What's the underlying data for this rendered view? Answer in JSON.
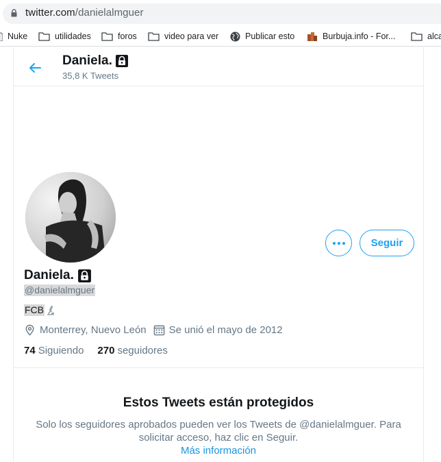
{
  "browser": {
    "url_domain": "twitter.com",
    "url_path": "/danielalmguer",
    "bookmarks": [
      {
        "label": "Nuke",
        "icon": "folder-icon"
      },
      {
        "label": "utilidades",
        "icon": "folder-icon"
      },
      {
        "label": "foros",
        "icon": "folder-icon"
      },
      {
        "label": "video para ver",
        "icon": "folder-icon"
      },
      {
        "label": "Publicar esto",
        "icon": "globe-icon"
      },
      {
        "label": "Burbuja.info - For...",
        "icon": "site-favicon-icon"
      },
      {
        "label": "alca",
        "icon": "folder-icon"
      }
    ]
  },
  "header": {
    "name": "Daniela.",
    "tweet_count": "35,8 K Tweets"
  },
  "profile": {
    "name": "Daniela.",
    "handle": "@danielalmguer",
    "bio": "FCB",
    "location": "Monterrey, Nuevo León",
    "joined": "Se unió el mayo de 2012",
    "following_count": "74",
    "following_label": "Siguiendo",
    "followers_count": "270",
    "followers_label": "seguidores",
    "follow_button": "Seguir"
  },
  "protected": {
    "title": "Estos Tweets están protegidos",
    "body": "Solo los seguidores aprobados pueden ver los Tweets de @danielalmguer. Para solicitar acceso, haz clic en Seguir.",
    "link": "Más información"
  },
  "colors": {
    "accent": "#1da1f2",
    "secondary_text": "#657786",
    "primary_text": "#14171a"
  }
}
